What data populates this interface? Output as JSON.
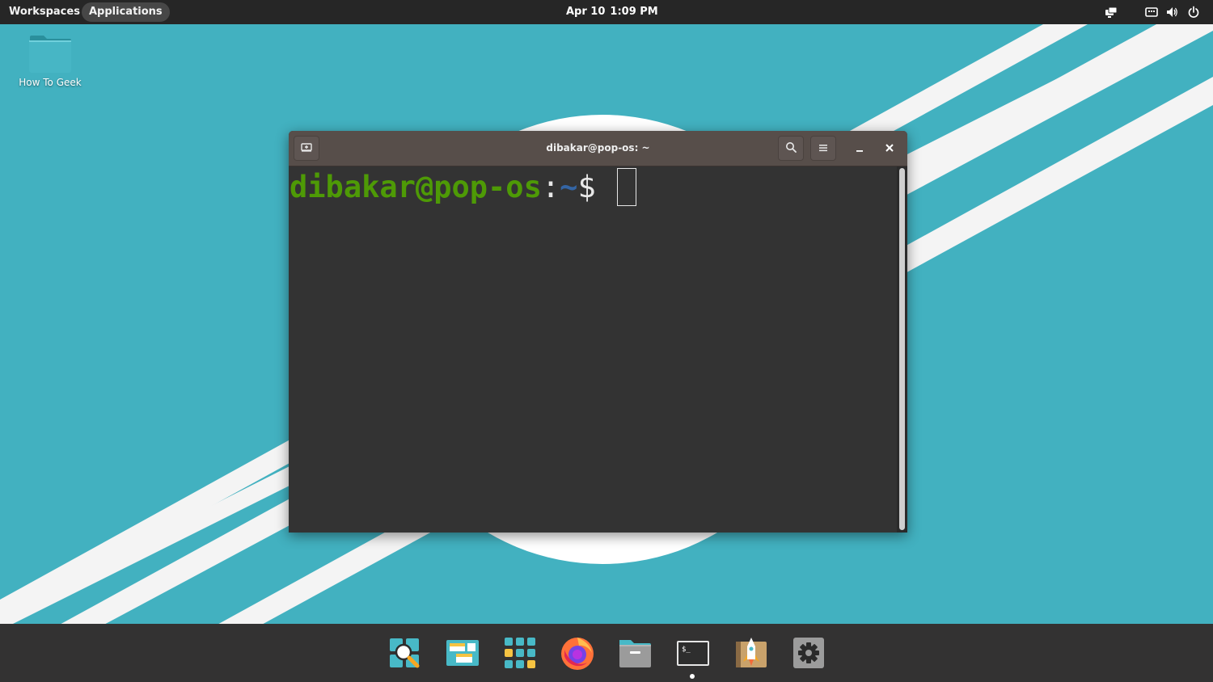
{
  "top_panel": {
    "workspaces_label": "Workspaces",
    "applications_label": "Applications",
    "date": "Apr 10",
    "time": "1:09 PM",
    "tray_icons": [
      "display-icon",
      "keyboard-icon",
      "volume-icon",
      "power-icon"
    ]
  },
  "desktop": {
    "items": [
      {
        "label": "How To Geek",
        "icon": "folder-icon"
      }
    ]
  },
  "terminal": {
    "title": "dibakar@pop-os: ~",
    "prompt_user": "dibakar@pop-os",
    "prompt_colon": ":",
    "prompt_path": "~",
    "prompt_dollar": "$ ",
    "colors": {
      "user": "#4e9a06",
      "path": "#3465a4",
      "background": "#333333",
      "titlebar": "#574e4a"
    }
  },
  "dock": {
    "items": [
      "pop-launcher-search-icon",
      "workspaces-icon",
      "applications-grid-icon",
      "firefox-icon",
      "files-icon",
      "terminal-icon",
      "pop-shop-icon",
      "settings-icon"
    ],
    "running": "terminal-icon"
  },
  "wallpaper": {
    "colors": {
      "background": "#42b1c0",
      "stripes": "#ffffff"
    }
  }
}
